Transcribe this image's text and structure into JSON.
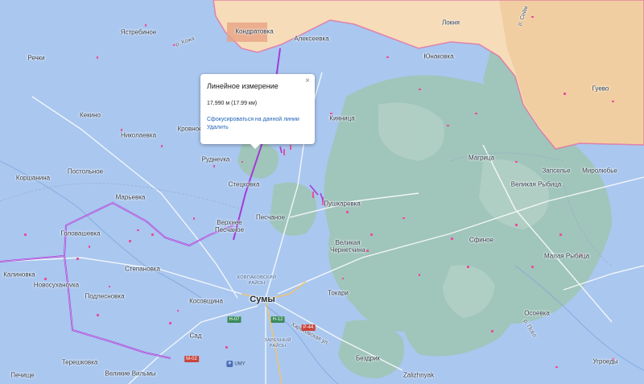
{
  "popup": {
    "title": "Линейное измерение",
    "close_icon": "×",
    "distance": "17,990 м (17.99 км)",
    "focus_link": "Сфокусироваться на данной линии",
    "delete_link": "Удалить"
  },
  "labels": {
    "kondratovka": "Кондратовка",
    "yastrebinoe": "Ястребиное",
    "aleksevka": "Алексеевка",
    "loknya": "Локня",
    "yunakovka": "Юнаковка",
    "guevo": "Гуево",
    "rechki": "Речки",
    "kekino": "Кекино",
    "nikolaevka": "Николаевка",
    "krovnoe": "Кровное",
    "kiyanitsa": "Кияница",
    "rudnevka": "Руднevка",
    "korshanina": "Коршанина",
    "postolnoe": "Постольное",
    "marevka": "Марьевка",
    "stetskovka": "Стецковка",
    "magritsa": "Магрица",
    "zapselye": "Запселье",
    "mirolyubye": "Миролюбье",
    "velikaya_rybitsa": "Великая Рыбица",
    "pushkarevka": "Пушкаревка",
    "verkhnee_pesochnoe": "Верхнее\nПесчаное",
    "pesochnoe": "Песчаное",
    "golovashevka": "Головашевка",
    "velikaya_chernetchina": "Великая\nЧернетчина",
    "sfinoe": "Сфиное",
    "stepanovka": "Степановка",
    "malaya_rybitsa": "Малая Рыбица",
    "kalinovka": "Калиновка",
    "novosukhanovka": "Новосуханovка",
    "kovpakovsky": "КОВПАКОВСКИЙ\nРАЙОН",
    "sumy": "Сумы",
    "podlesnovka": "Подлесновка",
    "kosovshchina": "Косовщина",
    "tokari": "Токари",
    "osoevka": "Осоевка",
    "sad": "Сад",
    "zarechny": "ЗАРЕЧНЫЙ\nРАЙОН",
    "kharkovskaya": "Харьковская ул.",
    "tereshkovka": "Терешковка",
    "pechishche": "Печище",
    "velikie_vilmy": "Великие Вильмы",
    "umy": "UMY",
    "bezdrik": "Бездрик",
    "zalizhnyak": "Zalizhnyak",
    "ugroedy": "Угроеды",
    "river_kozh": "р. Кожа",
    "river_seim": "р. Сейм",
    "river_psyol": "р. Псёл"
  },
  "roads": {
    "n07": "Н-07",
    "n12": "Н-12",
    "m02": "М-02",
    "r44": "Р-44"
  },
  "colors": {
    "water_blue": "#a9c6ef",
    "forest_green": "#9cc5b4",
    "russia_orange": "#f6dcb8",
    "measure_line": "#a23bd8",
    "front_line": "#9d3ad4",
    "hit_points": "#e8519d"
  }
}
